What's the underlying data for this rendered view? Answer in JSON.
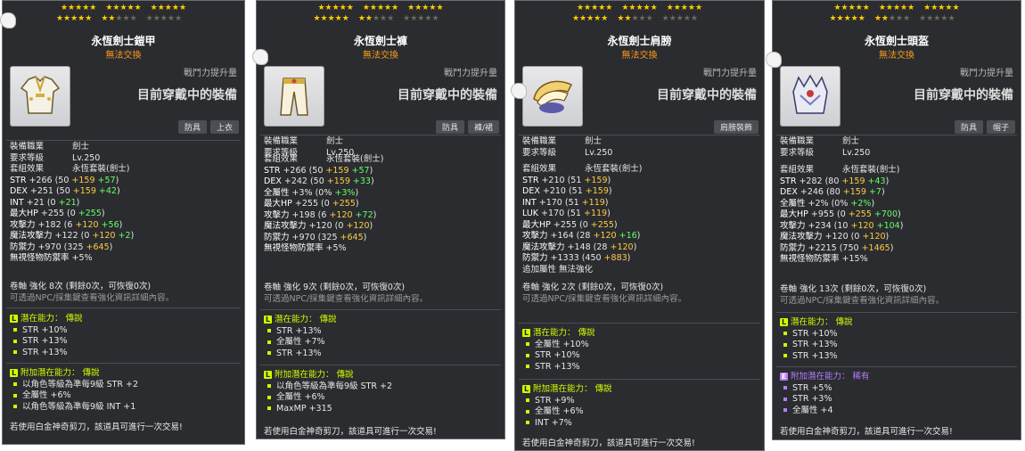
{
  "colors": {
    "star": "#ffcc00",
    "legendary": "#ccff00",
    "rare": "#b47dff",
    "no_trade": "#ff9b1c",
    "bonus_yellow": "#ffcc44",
    "bonus_green": "#66ff66"
  },
  "panels": [
    {
      "name": "永恆劍士鎧甲",
      "trade": "無法交換",
      "power_label": "戰鬥力提升量",
      "equipped": "目前穿戴中的裝備",
      "icon": "armor-icon",
      "tags": [
        "防具",
        "上衣"
      ],
      "job_label": "裝備職業",
      "job_value": "劍士",
      "level_label": "要求等級",
      "level_value": "Lv.250",
      "set_label": "套組效果",
      "set_value": "永恆套裝(劍士)",
      "stats": [
        {
          "k": "STR",
          "base": "+266",
          "open": " (50",
          "y": " +159",
          "g": " +57",
          "c": ")"
        },
        {
          "k": "DEX",
          "base": "+251",
          "open": " (50",
          "y": " +159",
          "g": " +42",
          "c": ")"
        },
        {
          "k": "INT",
          "base": "+21",
          "open": " (0",
          "y": "",
          "g": " +21",
          "c": ")"
        },
        {
          "k": "最大HP",
          "base": "+255",
          "open": " (0",
          "y": "",
          "g": " +255",
          "c": ")"
        },
        {
          "k": "攻擊力",
          "base": "+182",
          "open": " (6",
          "y": " +120",
          "g": " +56",
          "c": ")"
        },
        {
          "k": "魔法攻擊力",
          "base": "+122",
          "open": " (0",
          "y": " +120",
          "g": " +2",
          "c": ")"
        },
        {
          "k": "防禦力",
          "base": "+970",
          "open": " (325",
          "y": " +645",
          "g": "",
          "c": ")"
        },
        {
          "k": "無視怪物防禦率",
          "base": "+5%",
          "open": "",
          "y": "",
          "g": "",
          "c": ""
        }
      ],
      "extra_lines": [],
      "scroll": "卷軸 強化 8次 (剩餘0次，可恢復0次)",
      "scroll_note": "可透過NPC/採集鍵查看強化資訊詳細內容。",
      "pot_label": "潛在能力：",
      "pot_grade": "傳說",
      "pot_badge": "L",
      "pot_lines": [
        "STR +10%",
        "STR +13%",
        "STR +13%"
      ],
      "add_label": "附加潛在能力：",
      "add_grade": "傳說",
      "add_badge": "L",
      "add_lines": [
        "以角色等級為準每9級 STR +2",
        "全屬性 +6%",
        "以角色等級為準每9級 INT +1"
      ],
      "footer": "若使用白金神奇剪刀，該道具可進行一次交易!"
    },
    {
      "name": "永恆劍士褲",
      "trade": "無法交換",
      "power_label": "戰鬥力提升量",
      "equipped": "目前穿戴中的裝備",
      "icon": "pants-icon",
      "tags": [
        "防具",
        "褲/裙"
      ],
      "job_label": "裝備職業",
      "job_value": "劍士",
      "level_label": "要求等級",
      "level_value": "Lv.250",
      "set_label": "套組效果",
      "set_value": "永恆套裝(劍士)",
      "stats": [
        {
          "k": "STR",
          "base": "+266",
          "open": " (50",
          "y": " +159",
          "g": " +57",
          "c": ")"
        },
        {
          "k": "DEX",
          "base": "+242",
          "open": " (50",
          "y": " +159",
          "g": " +33",
          "c": ")"
        },
        {
          "k": "全屬性",
          "base": "+3%",
          "open": " (0%",
          "y": "",
          "g": " +3%",
          "c": ")"
        },
        {
          "k": "最大HP",
          "base": "+255",
          "open": " (0",
          "y": " +255",
          "g": "",
          "c": ")"
        },
        {
          "k": "攻擊力",
          "base": "+198",
          "open": " (6",
          "y": " +120",
          "g": " +72",
          "c": ")"
        },
        {
          "k": "魔法攻擊力",
          "base": "+120",
          "open": " (0",
          "y": " +120",
          "g": "",
          "c": ")"
        },
        {
          "k": "防禦力",
          "base": "+970",
          "open": " (325",
          "y": " +645",
          "g": "",
          "c": ")"
        },
        {
          "k": "無視怪物防禦率",
          "base": "+5%",
          "open": "",
          "y": "",
          "g": "",
          "c": ""
        }
      ],
      "extra_lines": [],
      "scroll": "卷軸 強化 9次 (剩餘0次，可恢復0次)",
      "scroll_note": "可透過NPC/採集鍵查看強化資訊詳細內容。",
      "pot_label": "潛在能力：",
      "pot_grade": "傳說",
      "pot_badge": "L",
      "pot_lines": [
        "STR +13%",
        "全屬性 +7%",
        "STR +13%"
      ],
      "add_label": "附加潛在能力：",
      "add_grade": "傳說",
      "add_badge": "L",
      "add_lines": [
        "以角色等級為準每9級 STR +2",
        "全屬性 +6%",
        "MaxMP +315"
      ],
      "footer": "若使用白金神奇剪刀，該道具可進行一次交易!"
    },
    {
      "name": "永恆劍士肩膀",
      "trade": "無法交換",
      "power_label": "戰鬥力提升量",
      "equipped": "目前穿戴中的裝備",
      "icon": "shoulder-icon",
      "tags": [
        "肩膀裝飾"
      ],
      "job_label": "裝備職業",
      "job_value": "劍士",
      "level_label": "要求等級",
      "level_value": "Lv.250",
      "set_label": "套組效果",
      "set_value": "永恆套裝(劍士)",
      "stats": [
        {
          "k": "STR",
          "base": "+210",
          "open": " (51",
          "y": " +159",
          "g": "",
          "c": ")"
        },
        {
          "k": "DEX",
          "base": "+210",
          "open": " (51",
          "y": " +159",
          "g": "",
          "c": ")"
        },
        {
          "k": "INT",
          "base": "+170",
          "open": " (51",
          "y": " +119",
          "g": "",
          "c": ")"
        },
        {
          "k": "LUK",
          "base": "+170",
          "open": " (51",
          "y": " +119",
          "g": "",
          "c": ")"
        },
        {
          "k": "最大HP",
          "base": "+255",
          "open": " (0",
          "y": " +255",
          "g": "",
          "c": ")"
        },
        {
          "k": "攻擊力",
          "base": "+164",
          "open": " (28",
          "y": " +120",
          "g": " +16",
          "c": ")"
        },
        {
          "k": "魔法攻擊力",
          "base": "+148",
          "open": " (28",
          "y": " +120",
          "g": "",
          "c": ")"
        },
        {
          "k": "防禦力",
          "base": "+1333",
          "open": " (450",
          "y": " +883",
          "g": "",
          "c": ")"
        }
      ],
      "extra_lines": [
        "追加屬性 無法強化"
      ],
      "scroll": "卷軸 強化 2次 (剩餘0次，可恢復0次)",
      "scroll_note": "可透過NPC/採集鍵查看強化資訊詳細內容。",
      "pot_label": "潛在能力：",
      "pot_grade": "傳說",
      "pot_badge": "L",
      "pot_lines": [
        "全屬性 +10%",
        "STR +10%",
        "STR +13%"
      ],
      "add_label": "附加潛在能力：",
      "add_grade": "傳說",
      "add_badge": "L",
      "add_lines": [
        "STR +9%",
        "全屬性 +6%",
        "INT +7%"
      ],
      "footer": "若使用白金神奇剪刀，該道具可進行一次交易!"
    },
    {
      "name": "永恆劍士頭盔",
      "trade": "無法交換",
      "power_label": "戰鬥力提升量",
      "equipped": "目前穿戴中的裝備",
      "icon": "helmet-icon",
      "tags": [
        "防具",
        "帽子"
      ],
      "job_label": "裝備職業",
      "job_value": "劍士",
      "level_label": "要求等級",
      "level_value": "Lv.250",
      "set_label": "套組效果",
      "set_value": "永恆套裝(劍士)",
      "stats": [
        {
          "k": "STR",
          "base": "+282",
          "open": " (80",
          "y": " +159",
          "g": " +43",
          "c": ")"
        },
        {
          "k": "DEX",
          "base": "+246",
          "open": " (80",
          "y": " +159",
          "g": " +7",
          "c": ")"
        },
        {
          "k": "全屬性",
          "base": "+2%",
          "open": " (0%",
          "y": "",
          "g": " +2%",
          "c": ")"
        },
        {
          "k": "最大HP",
          "base": "+955",
          "open": " (0",
          "y": " +255",
          "g": " +700",
          "c": ")"
        },
        {
          "k": "攻擊力",
          "base": "+234",
          "open": " (10",
          "y": " +120",
          "g": " +104",
          "c": ")"
        },
        {
          "k": "魔法攻擊力",
          "base": "+120",
          "open": " (0",
          "y": " +120",
          "g": "",
          "c": ")"
        },
        {
          "k": "防禦力",
          "base": "+2215",
          "open": " (750",
          "y": " +1465",
          "g": "",
          "c": ")"
        },
        {
          "k": "無視怪物防禦率",
          "base": "+15%",
          "open": "",
          "y": "",
          "g": "",
          "c": ""
        }
      ],
      "extra_lines": [],
      "scroll": "卷軸 強化 13次 (剩餘0次，可恢復0次)",
      "scroll_note": "可透過NPC/採集鍵查看強化資訊詳細內容。",
      "pot_label": "潛在能力：",
      "pot_grade": "傳說",
      "pot_badge": "L",
      "pot_lines": [
        "STR +10%",
        "STR +13%",
        "STR +13%"
      ],
      "add_label": "附加潛在能力：",
      "add_grade": "稀有",
      "add_badge": "E",
      "add_lines": [
        "STR +5%",
        "STR +3%",
        "全屬性 +4"
      ],
      "footer": "若使用白金神奇剪刀，該道具可進行一次交易!"
    }
  ]
}
